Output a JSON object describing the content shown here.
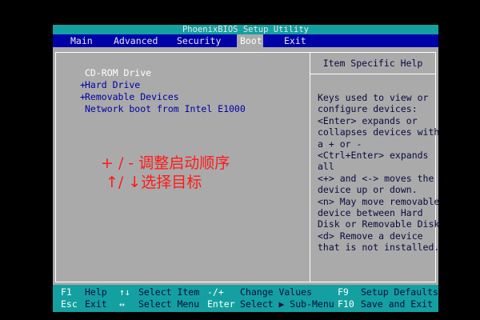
{
  "window": {
    "title": "PhoenixBIOS Setup Utility"
  },
  "menu": {
    "items": [
      {
        "label": "Main",
        "active": false
      },
      {
        "label": "Advanced",
        "active": false
      },
      {
        "label": "Security",
        "active": false
      },
      {
        "label": "Boot",
        "active": true
      },
      {
        "label": "Exit",
        "active": false
      }
    ]
  },
  "boot": {
    "items": [
      {
        "prefix": "",
        "label": "CD-ROM Drive",
        "selected": true
      },
      {
        "prefix": "+",
        "label": "Hard Drive",
        "selected": false
      },
      {
        "prefix": "+",
        "label": "Removable Devices",
        "selected": false
      },
      {
        "prefix": "",
        "label": "Network boot from Intel E1000",
        "selected": false
      }
    ]
  },
  "help": {
    "title": "Item Specific Help",
    "lines": [
      "Keys used to view or",
      "configure devices:",
      "<Enter> expands or",
      "collapses devices with",
      "a + or -",
      "<Ctrl+Enter> expands",
      "all",
      "<+> and <-> moves the",
      "device up or down.",
      "<n> May move removable",
      "device between Hard",
      "Disk or Removable Disk",
      "<d> Remove a device",
      "that is not installed."
    ]
  },
  "annotation": {
    "line1": "+ / - 调整启动顺序",
    "line2": "↑/ ↓选择目标",
    "color": "#ff1a1a"
  },
  "footer": {
    "row1": {
      "f1_key": "F1",
      "f1_desc": "Help",
      "updown_key": "↑↓",
      "updown_desc": "Select Item",
      "pm_key": "-/+",
      "pm_desc": "Change Values",
      "f9_key": "F9",
      "f9_desc": "Setup Defaults"
    },
    "row2": {
      "esc_key": "Esc",
      "esc_desc": "Exit",
      "lr_key": "↔",
      "lr_desc": "Select Menu",
      "enter_key": "Enter",
      "enter_desc": "Select ▶ Sub-Menu",
      "f10_key": "F10",
      "f10_desc": "Save and Exit"
    }
  },
  "colors": {
    "background": "#000000",
    "panel": "#aaaaaa",
    "menubar": "#0000a8",
    "title_bar": "#14a0a0",
    "footer_bar": "#14a0a0",
    "item_text": "#0000a8",
    "selected_text": "#ffffff"
  }
}
